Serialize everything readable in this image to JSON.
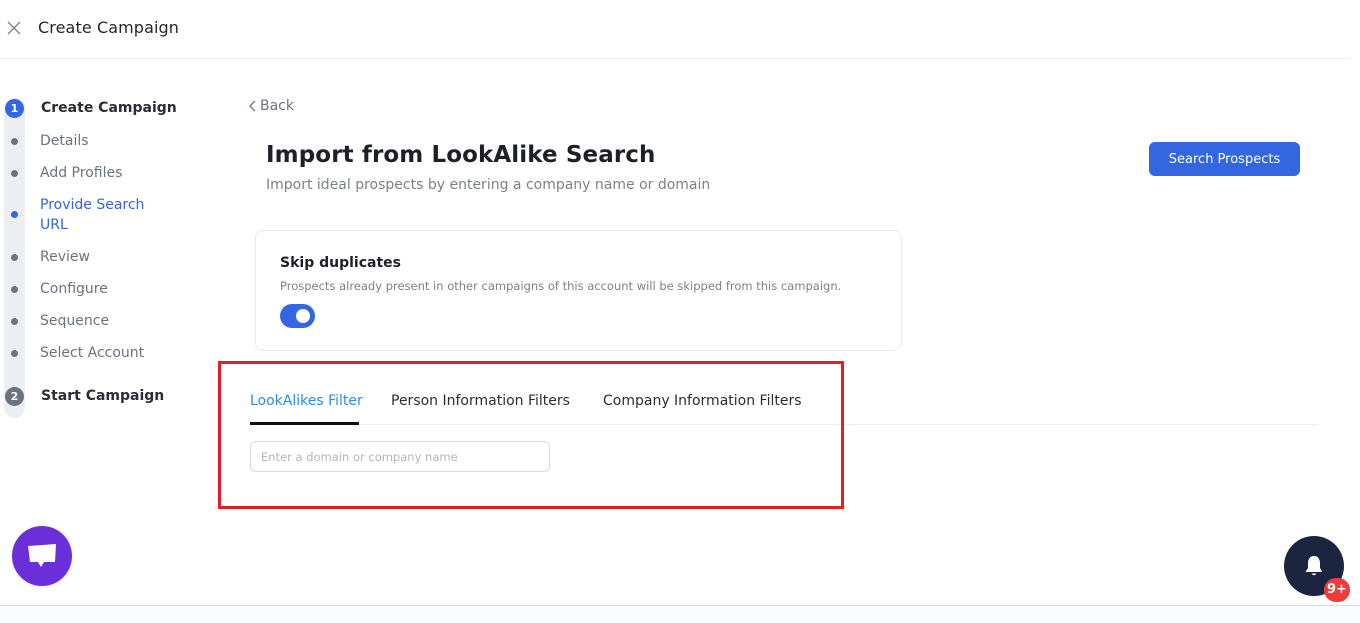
{
  "header": {
    "title": "Create Campaign",
    "close_icon": "close-icon"
  },
  "stepper": {
    "steps": [
      {
        "number": "1",
        "title": "Create Campaign",
        "state": "active",
        "substeps": [
          {
            "label": "Details",
            "state": "done"
          },
          {
            "label": "Add Profiles",
            "state": "done"
          },
          {
            "label": "Provide Search URL",
            "state": "active"
          },
          {
            "label": "Review",
            "state": "pending"
          },
          {
            "label": "Configure",
            "state": "pending"
          },
          {
            "label": "Sequence",
            "state": "pending"
          },
          {
            "label": "Select Account",
            "state": "pending"
          }
        ]
      },
      {
        "number": "2",
        "title": "Start Campaign",
        "state": "inactive"
      }
    ]
  },
  "main": {
    "back_label": "Back",
    "title": "Import from LookAlike Search",
    "subtitle": "Import ideal prospects by entering a company name or domain",
    "search_prospects_label": "Search Prospects",
    "skip_duplicates": {
      "title": "Skip duplicates",
      "description": "Prospects already present in other campaigns of this account will be skipped from this campaign.",
      "enabled": true
    },
    "tabs": [
      {
        "label": "LookAlikes Filter",
        "active": true
      },
      {
        "label": "Person Information Filters",
        "active": false
      },
      {
        "label": "Company Information Filters",
        "active": false
      }
    ],
    "domain_input": {
      "value": "",
      "placeholder": "Enter a domain or company name"
    }
  },
  "floating": {
    "chat_icon": "chat-bubble-icon",
    "notification_icon": "bell-icon",
    "notification_badge": "9+"
  },
  "colors": {
    "accent": "#3366e0",
    "active_tab": "#2f8be0",
    "highlight": "#e01f26",
    "chat_fab": "#6a2fd9",
    "notif_fab": "#1b2540",
    "badge": "#ef3b3b"
  }
}
